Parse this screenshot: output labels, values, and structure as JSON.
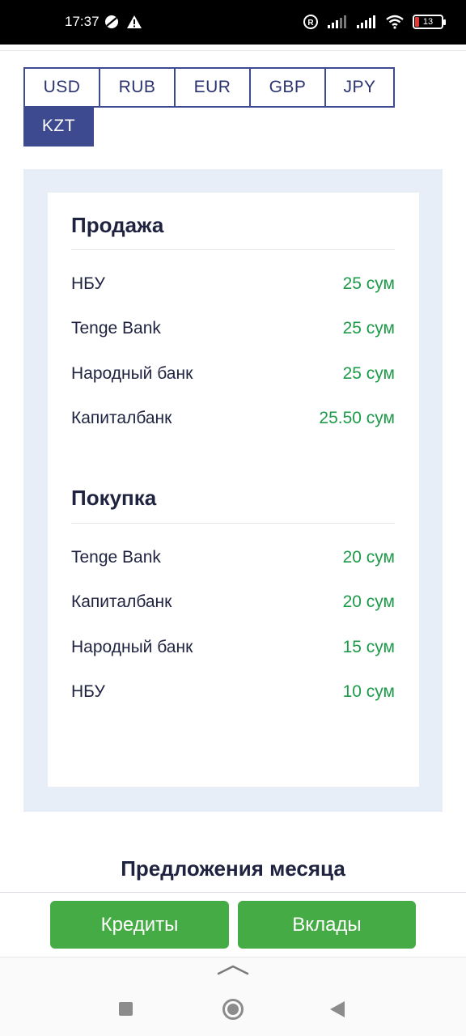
{
  "status_bar": {
    "time": "17:37",
    "battery_level": "13",
    "icons": [
      "data-saver-icon",
      "warning-icon",
      "registered-icon",
      "signal-icon",
      "signal-icon",
      "wifi-icon",
      "battery-icon"
    ]
  },
  "currency_tabs": [
    {
      "label": "USD",
      "active": false
    },
    {
      "label": "RUB",
      "active": false
    },
    {
      "label": "EUR",
      "active": false
    },
    {
      "label": "GBP",
      "active": false
    },
    {
      "label": "JPY",
      "active": false
    },
    {
      "label": "KZT",
      "active": true
    }
  ],
  "sell": {
    "title": "Продажа",
    "rows": [
      {
        "bank": "НБУ",
        "value": "25 сум"
      },
      {
        "bank": "Tenge Bank",
        "value": "25 сум"
      },
      {
        "bank": "Народный банк",
        "value": "25 сум"
      },
      {
        "bank": "Капиталбанк",
        "value": "25.50 сум"
      }
    ]
  },
  "buy": {
    "title": "Покупка",
    "rows": [
      {
        "bank": "Tenge Bank",
        "value": "20 сум"
      },
      {
        "bank": "Капиталбанк",
        "value": "20 сум"
      },
      {
        "bank": "Народный банк",
        "value": "15 сум"
      },
      {
        "bank": "НБУ",
        "value": "10 сум"
      }
    ]
  },
  "offers": {
    "title": "Предложения месяца"
  },
  "actions": {
    "credits_label": "Кредиты",
    "deposits_label": "Вклады"
  },
  "colors": {
    "accent": "#3d4a8f",
    "rate_value": "#1e9a4a",
    "button": "#45ac45",
    "panel_bg": "#e8eef8"
  }
}
